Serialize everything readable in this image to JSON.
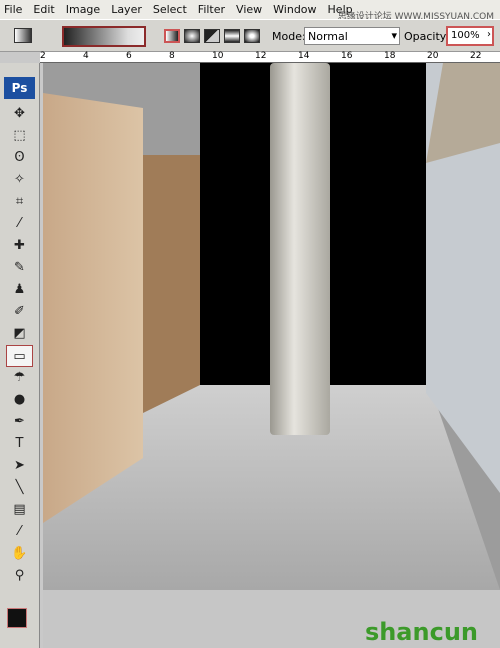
{
  "menu": [
    "File",
    "Edit",
    "Image",
    "Layer",
    "Select",
    "Filter",
    "View",
    "Window",
    "Help"
  ],
  "watermark": "思缘设计论坛 WWW.MISSYUAN.COM",
  "options": {
    "mode_label": "Mode:",
    "mode_value": "Normal",
    "opacity_label": "Opacity:",
    "opacity_value": "100%"
  },
  "ruler": [
    "2",
    "4",
    "6",
    "8",
    "10",
    "12",
    "14",
    "16",
    "18",
    "20",
    "22"
  ],
  "toolbox": {
    "logo": "Ps",
    "tools": [
      {
        "n": "move",
        "g": "✥"
      },
      {
        "n": "marquee",
        "g": "⬚"
      },
      {
        "n": "lasso",
        "g": "ʘ"
      },
      {
        "n": "magic-wand",
        "g": "✧"
      },
      {
        "n": "crop",
        "g": "⌗"
      },
      {
        "n": "slice",
        "g": "⁄"
      },
      {
        "n": "healing",
        "g": "✚"
      },
      {
        "n": "brush",
        "g": "✎"
      },
      {
        "n": "stamp",
        "g": "♟"
      },
      {
        "n": "history-brush",
        "g": "✐"
      },
      {
        "n": "eraser",
        "g": "◩"
      },
      {
        "n": "gradient",
        "g": "▭",
        "sel": true
      },
      {
        "n": "blur",
        "g": "☂"
      },
      {
        "n": "dodge",
        "g": "●"
      },
      {
        "n": "pen",
        "g": "✒"
      },
      {
        "n": "type",
        "g": "T"
      },
      {
        "n": "path-select",
        "g": "➤"
      },
      {
        "n": "line",
        "g": "╲"
      },
      {
        "n": "notes",
        "g": "▤"
      },
      {
        "n": "eyedropper",
        "g": "⁄"
      },
      {
        "n": "hand",
        "g": "✋"
      },
      {
        "n": "zoom",
        "g": "⚲"
      }
    ]
  },
  "logo": "shancun"
}
